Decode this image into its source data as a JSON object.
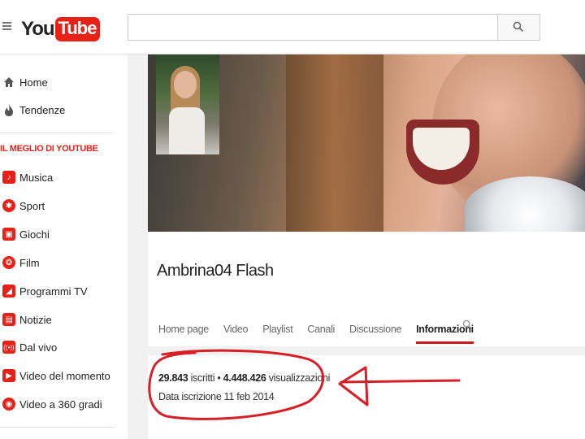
{
  "header": {
    "logo_you": "You",
    "logo_tube": "Tube",
    "search_placeholder": ""
  },
  "sidebar": {
    "items_top": [
      {
        "label": "Home",
        "icon": "home-icon"
      },
      {
        "label": "Tendenze",
        "icon": "flame-icon"
      }
    ],
    "section_title": "IL MEGLIO DI YOUTUBE",
    "items_best": [
      {
        "label": "Musica",
        "icon": "music-icon"
      },
      {
        "label": "Sport",
        "icon": "sport-icon"
      },
      {
        "label": "Giochi",
        "icon": "gamepad-icon"
      },
      {
        "label": "Film",
        "icon": "film-icon"
      },
      {
        "label": "Programmi TV",
        "icon": "tv-icon"
      },
      {
        "label": "Notizie",
        "icon": "news-icon"
      },
      {
        "label": "Dal vivo",
        "icon": "live-icon"
      },
      {
        "label": "Video del momento",
        "icon": "trending-video-icon"
      },
      {
        "label": "Video a 360 gradi",
        "icon": "360-icon"
      }
    ]
  },
  "channel": {
    "name": "Ambrina04 Flash",
    "tabs": [
      "Home page",
      "Video",
      "Playlist",
      "Canali",
      "Discussione",
      "Informazioni"
    ],
    "active_tab": "Informazioni"
  },
  "about": {
    "subscribers": "29.843",
    "subscribers_label": "iscritti",
    "separator": "•",
    "views": "4.448.426",
    "views_label": "visualizzazioni",
    "joined": "Data iscrizione 11 feb 2014"
  },
  "colors": {
    "brand_red": "#e62117",
    "tab_underline": "#cc181e",
    "annotation": "#d61f26"
  }
}
